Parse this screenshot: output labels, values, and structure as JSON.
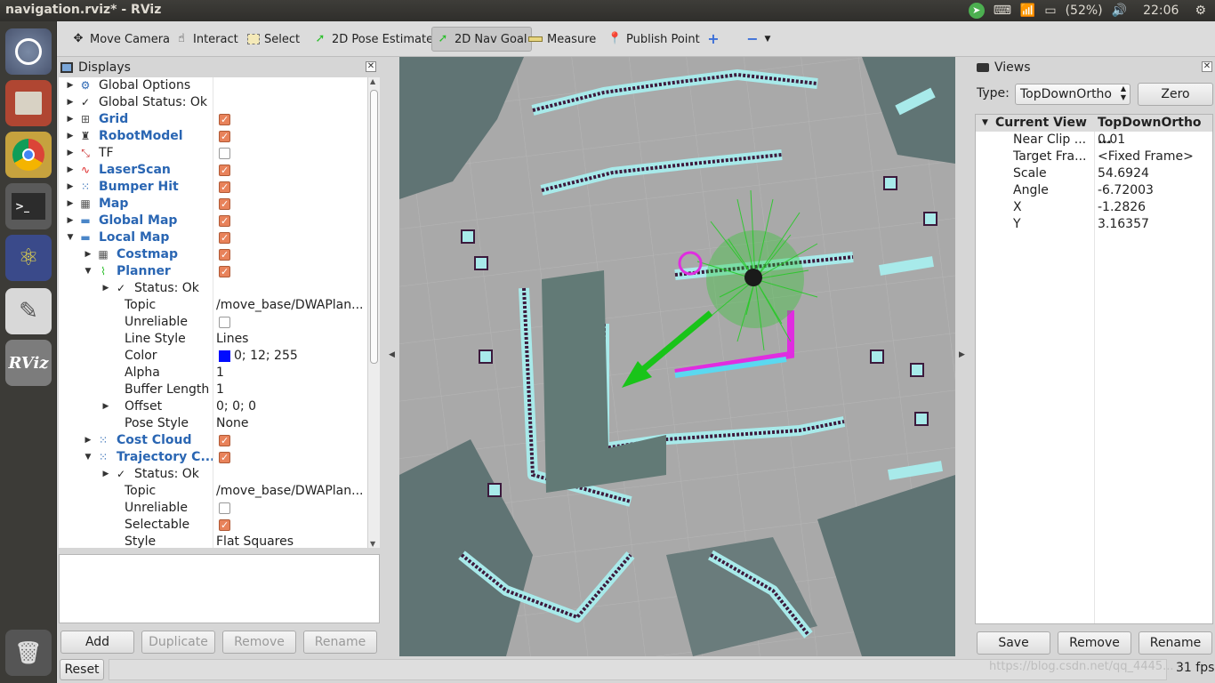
{
  "topbar": {
    "title": "navigation.rviz* - RViz",
    "battery": "(52%)",
    "clock": "22:06"
  },
  "toolbar": {
    "tools": [
      {
        "label": "Move Camera",
        "icon": "move-camera-icon"
      },
      {
        "label": "Interact",
        "icon": "hand-icon"
      },
      {
        "label": "Select",
        "icon": "select-box-icon"
      },
      {
        "label": "2D Pose Estimate",
        "icon": "green-arrow-icon"
      },
      {
        "label": "2D Nav Goal",
        "icon": "green-arrow-icon"
      },
      {
        "label": "Measure",
        "icon": "ruler-icon"
      },
      {
        "label": "Publish Point",
        "icon": "map-pin-icon"
      }
    ]
  },
  "displays": {
    "title": "Displays",
    "rows": [
      {
        "label": "Global Options",
        "value": ""
      },
      {
        "label": "Global Status: Ok",
        "value": ""
      },
      {
        "label": "Grid",
        "value": ""
      },
      {
        "label": "RobotModel",
        "value": ""
      },
      {
        "label": "TF",
        "value": ""
      },
      {
        "label": "LaserScan",
        "value": ""
      },
      {
        "label": "Bumper Hit",
        "value": ""
      },
      {
        "label": "Map",
        "value": ""
      },
      {
        "label": "Global Map",
        "value": ""
      },
      {
        "label": "Local Map",
        "value": ""
      },
      {
        "label": "Costmap",
        "value": ""
      },
      {
        "label": "Planner",
        "value": ""
      },
      {
        "label": "Status: Ok",
        "value": ""
      },
      {
        "label": "Topic",
        "value": "/move_base/DWAPlan..."
      },
      {
        "label": "Unreliable",
        "value": ""
      },
      {
        "label": "Line Style",
        "value": "Lines"
      },
      {
        "label": "Color",
        "value": "0; 12; 255"
      },
      {
        "label": "Alpha",
        "value": "1"
      },
      {
        "label": "Buffer Length",
        "value": "1"
      },
      {
        "label": "Offset",
        "value": "0; 0; 0"
      },
      {
        "label": "Pose Style",
        "value": "None"
      },
      {
        "label": "Cost Cloud",
        "value": ""
      },
      {
        "label": "Trajectory C...",
        "value": ""
      },
      {
        "label": "Status: Ok",
        "value": ""
      },
      {
        "label": "Topic",
        "value": "/move_base/DWAPlan..."
      },
      {
        "label": "Unreliable",
        "value": ""
      },
      {
        "label": "Selectable",
        "value": ""
      },
      {
        "label": "Style",
        "value": "Flat Squares"
      }
    ],
    "buttons": {
      "add": "Add",
      "duplicate": "Duplicate",
      "remove": "Remove",
      "rename": "Rename"
    }
  },
  "views": {
    "title": "Views",
    "type_label": "Type:",
    "type_value": "TopDownOrtho",
    "zero": "Zero",
    "header": {
      "col1": "Current View",
      "col2": "TopDownOrtho ..."
    },
    "props": [
      {
        "label": "Near Clip ...",
        "value": "0.01"
      },
      {
        "label": "Target Fra...",
        "value": "<Fixed Frame>"
      },
      {
        "label": "Scale",
        "value": "54.6924"
      },
      {
        "label": "Angle",
        "value": "-6.72003"
      },
      {
        "label": "X",
        "value": "-1.2826"
      },
      {
        "label": "Y",
        "value": "3.16357"
      }
    ],
    "buttons": {
      "save": "Save",
      "remove": "Remove",
      "rename": "Rename"
    }
  },
  "status": {
    "reset": "Reset",
    "fps": "31 fps",
    "watermark": "https://blog.csdn.net/qq_4445..."
  },
  "colors": {
    "accent_orange": "#e8825a",
    "link_blue": "#2a66b3",
    "planner_color": "#000cff",
    "nav_arrow": "#22cc22"
  }
}
